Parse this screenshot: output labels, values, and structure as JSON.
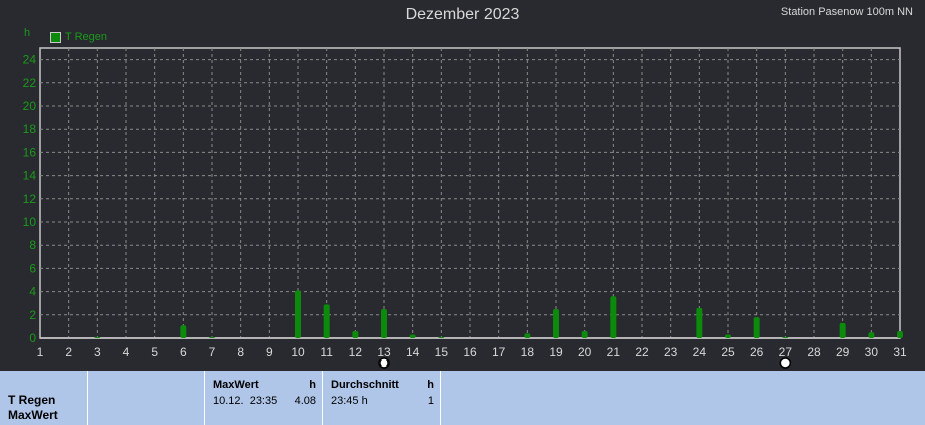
{
  "header": {
    "title": "Dezember 2023",
    "station": "Station Pasenow 100m NN",
    "unit": "h"
  },
  "chart_data": {
    "type": "bar",
    "title": "Dezember 2023",
    "ylabel": "h",
    "xlabel": "",
    "ylim": [
      0,
      25
    ],
    "yticks": [
      0,
      2,
      4,
      6,
      8,
      10,
      12,
      14,
      16,
      18,
      20,
      22,
      24
    ],
    "grid": true,
    "legend_position": "top-left",
    "categories": [
      "1",
      "2",
      "3",
      "4",
      "5",
      "6",
      "7",
      "8",
      "9",
      "10",
      "11",
      "12",
      "13",
      "14",
      "15",
      "16",
      "17",
      "18",
      "19",
      "20",
      "21",
      "22",
      "23",
      "24",
      "25",
      "26",
      "27",
      "28",
      "29",
      "30",
      "31"
    ],
    "series": [
      {
        "name": "T Regen",
        "color": "#0b8a0b",
        "values": [
          0,
          0,
          0.1,
          0,
          0,
          1.1,
          0.1,
          0,
          0,
          4.1,
          2.9,
          0.6,
          2.5,
          0.3,
          0.1,
          0,
          0,
          0.4,
          2.5,
          0.6,
          3.6,
          0,
          0,
          2.6,
          0.3,
          1.8,
          0.1,
          0,
          1.3,
          0.5,
          0.6
        ]
      }
    ],
    "markers": [
      {
        "day": "13",
        "icon": "full-moon-icon"
      },
      {
        "day": "27",
        "icon": "new-moon-icon"
      }
    ]
  },
  "panel": {
    "series_name": "T Regen",
    "series_stat": "MaxWert",
    "max_header": "MaxWert",
    "max_unit": "h",
    "max_time": "10.12.  23:35",
    "max_value": "4.08",
    "avg_header": "Durchschnitt",
    "avg_unit": "h",
    "avg_time": "23:45 h",
    "avg_value": "1"
  }
}
